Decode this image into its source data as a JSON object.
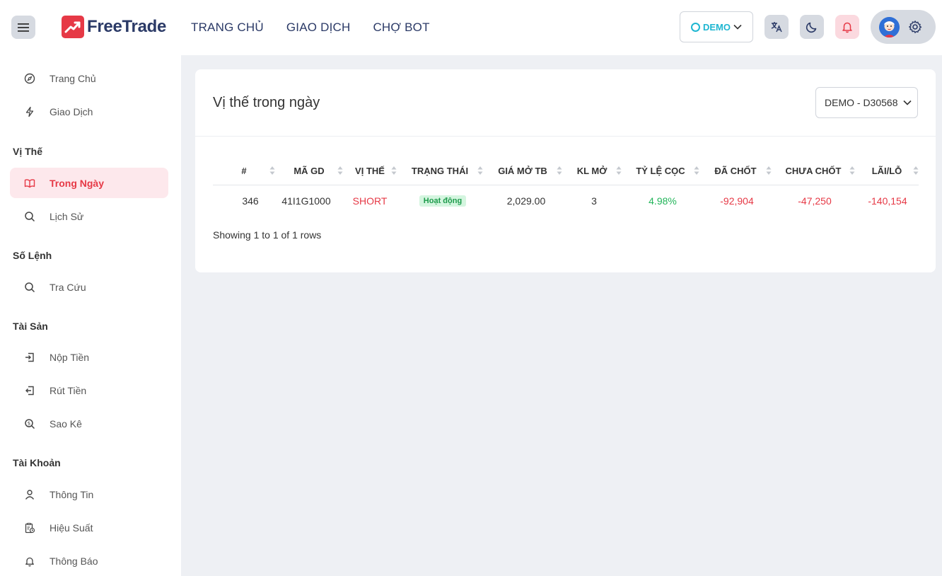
{
  "brand": {
    "name": "FreeTrade"
  },
  "topnav": [
    "TRANG CHỦ",
    "GIAO DỊCH",
    "CHỢ BOT"
  ],
  "header": {
    "mode": "DEMO"
  },
  "sidebar": {
    "top_items": [
      {
        "label": "Trang Chủ",
        "icon": "compass-icon"
      },
      {
        "label": "Giao Dịch",
        "icon": "bolt-icon"
      }
    ],
    "sections": [
      {
        "title": "Vị Thế",
        "items": [
          {
            "label": "Trong Ngày",
            "icon": "book-icon",
            "active": true
          },
          {
            "label": "Lịch Sử",
            "icon": "search-icon"
          }
        ]
      },
      {
        "title": "Số Lệnh",
        "items": [
          {
            "label": "Tra Cứu",
            "icon": "search-icon"
          }
        ]
      },
      {
        "title": "Tài Sản",
        "items": [
          {
            "label": "Nộp Tiền",
            "icon": "deposit-icon"
          },
          {
            "label": "Rút Tiền",
            "icon": "withdraw-icon"
          },
          {
            "label": "Sao Kê",
            "icon": "statement-search-icon"
          }
        ]
      },
      {
        "title": "Tài Khoản",
        "items": [
          {
            "label": "Thông Tin",
            "icon": "user-icon"
          },
          {
            "label": "Hiệu Suất",
            "icon": "clipboard-clock-icon"
          },
          {
            "label": "Thông Báo",
            "icon": "bell-icon"
          }
        ]
      }
    ]
  },
  "main": {
    "title": "Vị thế trong ngày",
    "account_select": "DEMO - D30568",
    "table": {
      "columns": [
        "#",
        "MÃ GD",
        "VỊ THẾ",
        "TRẠNG THÁI",
        "GIÁ MỞ TB",
        "KL MỞ",
        "TỶ LỆ CỌC",
        "ĐÃ CHỐT",
        "CHƯA CHỐT",
        "LÃI/LỖ"
      ],
      "rows": [
        {
          "id": "346",
          "code": "41I1G1000",
          "side": "SHORT",
          "status": "Hoạt động",
          "avg_price": "2,029.00",
          "open_qty": "3",
          "margin_ratio": "4.98%",
          "realized": "-92,904",
          "unrealized": "-47,250",
          "pnl": "-140,154"
        }
      ]
    },
    "footer": "Showing 1 to 1 of 1 rows"
  },
  "colors": {
    "accent": "#e63946",
    "positive": "#22b55a",
    "demo": "#1eb6d1",
    "navy": "#2b3a67"
  }
}
